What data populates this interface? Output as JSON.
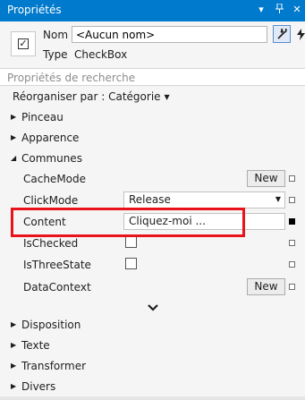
{
  "window": {
    "title": "Propriétés",
    "controls": [
      "dropdown-icon",
      "pin-icon",
      "close-icon"
    ],
    "accent": "#007acc"
  },
  "header": {
    "name_label": "Nom",
    "name_value": "<Aucun nom>",
    "type_label": "Type",
    "type_value": "CheckBox",
    "buttons": [
      "wrench-icon",
      "lightning-icon"
    ]
  },
  "search": {
    "placeholder": "Propriétés de recherche"
  },
  "arrange": {
    "label": "Réorganiser par : Catégorie"
  },
  "categories": {
    "pinceau": "Pinceau",
    "apparence": "Apparence",
    "communes": "Communes",
    "disposition": "Disposition",
    "texte": "Texte",
    "transformer": "Transformer",
    "divers": "Divers"
  },
  "properties": {
    "cachemode": {
      "name": "CacheMode",
      "button": "New"
    },
    "clickmode": {
      "name": "ClickMode",
      "value": "Release"
    },
    "content": {
      "name": "Content",
      "value": "Cliquez-moi ..."
    },
    "ischecked": {
      "name": "IsChecked",
      "checked": false
    },
    "isthreestate": {
      "name": "IsThreeState",
      "checked": false
    },
    "datacontext": {
      "name": "DataContext",
      "button": "New"
    }
  },
  "highlight_color": "#e8141b"
}
